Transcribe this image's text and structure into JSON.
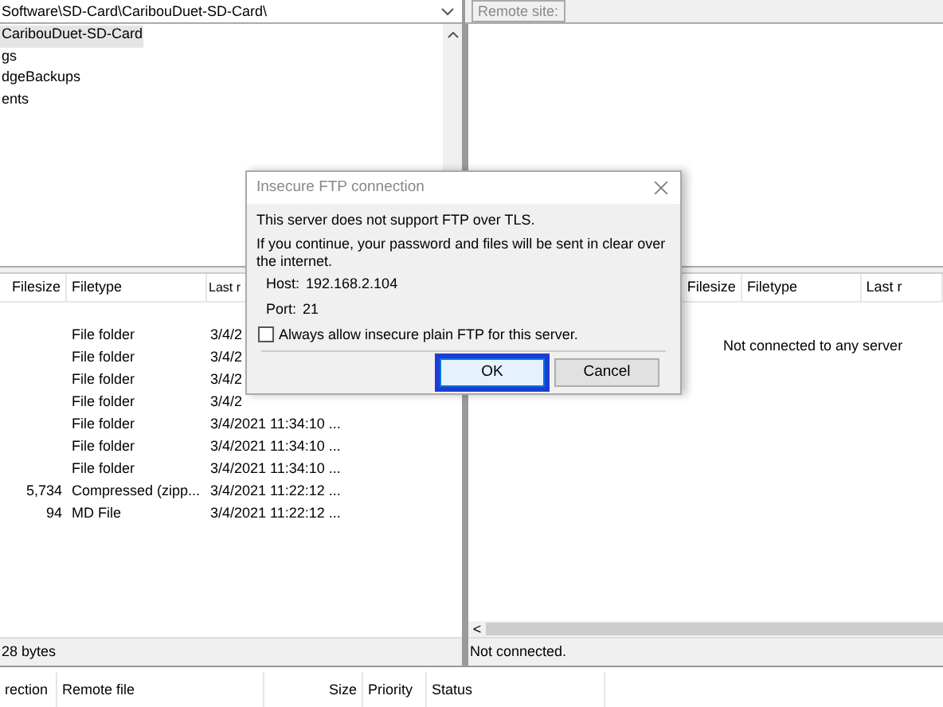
{
  "local": {
    "path": "Software\\SD-Card\\CaribouDuet-SD-Card\\",
    "tree": [
      {
        "label": "CaribouDuet-SD-Card",
        "selected": true
      },
      {
        "label": "gs",
        "selected": false
      },
      {
        "label": "dgeBackups",
        "selected": false
      },
      {
        "label": "ents",
        "selected": false
      }
    ],
    "columns": [
      "Filesize",
      "Filetype",
      "Last r"
    ],
    "rows": [
      {
        "size": "",
        "type": "File folder",
        "modified": "3/4/2"
      },
      {
        "size": "",
        "type": "File folder",
        "modified": "3/4/2"
      },
      {
        "size": "",
        "type": "File folder",
        "modified": "3/4/2"
      },
      {
        "size": "",
        "type": "File folder",
        "modified": "3/4/2"
      },
      {
        "size": "",
        "type": "File folder",
        "modified": "3/4/2021 11:34:10 ..."
      },
      {
        "size": "",
        "type": "File folder",
        "modified": "3/4/2021 11:34:10 ..."
      },
      {
        "size": "",
        "type": "File folder",
        "modified": "3/4/2021 11:34:10 ..."
      },
      {
        "size": "5,734",
        "type": "Compressed (zipp...",
        "modified": "3/4/2021 11:22:12 ..."
      },
      {
        "size": "94",
        "type": "MD File",
        "modified": "3/4/2021 11:22:12 ..."
      }
    ],
    "status": "28 bytes"
  },
  "remote": {
    "label": "Remote site:",
    "columns": [
      "Filesize",
      "Filetype",
      "Last r"
    ],
    "message": "Not connected to any server",
    "scroll_arrow": "<",
    "status": "Not connected."
  },
  "queue": {
    "columns": [
      "rection",
      "Remote file",
      "Size",
      "Priority",
      "Status"
    ]
  },
  "dialog": {
    "title": "Insecure FTP connection",
    "lines": [
      "This server does not support FTP over TLS.",
      "If you continue, your password and files will be sent in clear over the internet."
    ],
    "host_label": "Host:",
    "host": "192.168.2.104",
    "port_label": "Port:",
    "port": "21",
    "checkbox": {
      "label": "Always allow insecure plain FTP for this server.",
      "checked": false
    },
    "buttons": [
      {
        "label": "OK",
        "focused": true
      },
      {
        "label": "Cancel",
        "focused": false
      }
    ]
  }
}
